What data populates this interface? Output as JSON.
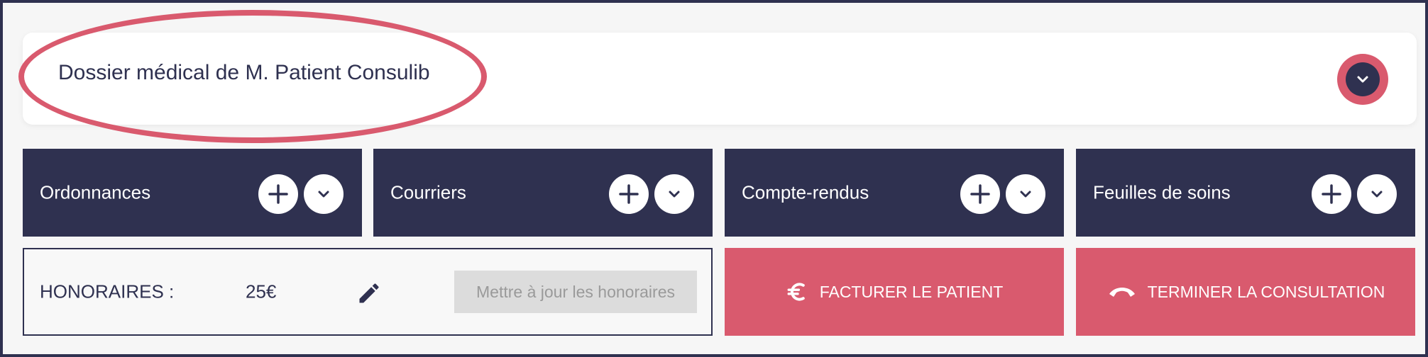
{
  "header": {
    "title": "Dossier médical de M. Patient Consulib",
    "expand_icon": "chevron-down-icon"
  },
  "sections": [
    {
      "label": "Ordonnances"
    },
    {
      "label": "Courriers"
    },
    {
      "label": "Compte-rendus"
    },
    {
      "label": "Feuilles de soins"
    }
  ],
  "fees": {
    "label": "HONORAIRES :",
    "amount": "25€",
    "edit_icon": "pencil-icon",
    "update_button": "Mettre à jour les honoraires"
  },
  "actions": {
    "bill_label": "FACTURER LE PATIENT",
    "bill_icon": "euro-icon",
    "end_label": "TERMINER LA CONSULTATION",
    "end_icon": "hang-up-phone-icon"
  },
  "colors": {
    "navy": "#2f3150",
    "accent": "#d95a6e",
    "background": "#f6f6f6",
    "disabled": "#dcdcdc"
  }
}
